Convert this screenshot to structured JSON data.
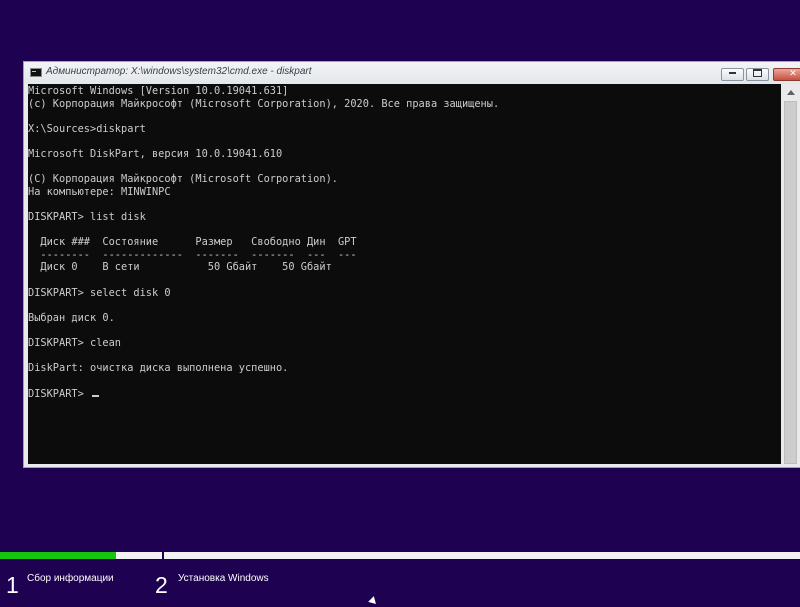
{
  "window": {
    "title": "Администратор: X:\\windows\\system32\\cmd.exe - diskpart",
    "title_icon": "cmd-icon"
  },
  "console": {
    "lines": [
      "Microsoft Windows [Version 10.0.19041.631]",
      "(c) Корпорация Майкрософт (Microsoft Corporation), 2020. Все права защищены.",
      "",
      "X:\\Sources>diskpart",
      "",
      "Microsoft DiskPart, версия 10.0.19041.610",
      "",
      "(C) Корпорация Майкрософт (Microsoft Corporation).",
      "На компьютере: MINWINPC",
      "",
      "DISKPART> list disk",
      "",
      "  Диск ###  Состояние      Размер   Свободно Дин  GPT",
      "  --------  -------------  -------  -------  ---  ---",
      "  Диск 0    В сети           50 Gбайт    50 Gбайт",
      "",
      "DISKPART> select disk 0",
      "",
      "Выбран диск 0.",
      "",
      "DISKPART> clean",
      "",
      "DiskPart: очистка диска выполнена успешно.",
      ""
    ],
    "prompt": "DISKPART> "
  },
  "setup": {
    "progress_fraction": 0.145,
    "steps": [
      {
        "number": "1",
        "label": "Сбор информации"
      },
      {
        "number": "2",
        "label": "Установка Windows"
      }
    ]
  },
  "colors": {
    "background": "#1e0150",
    "progress": "#16c60c",
    "console_bg": "#0c0c0c",
    "console_fg": "#cccccc"
  }
}
